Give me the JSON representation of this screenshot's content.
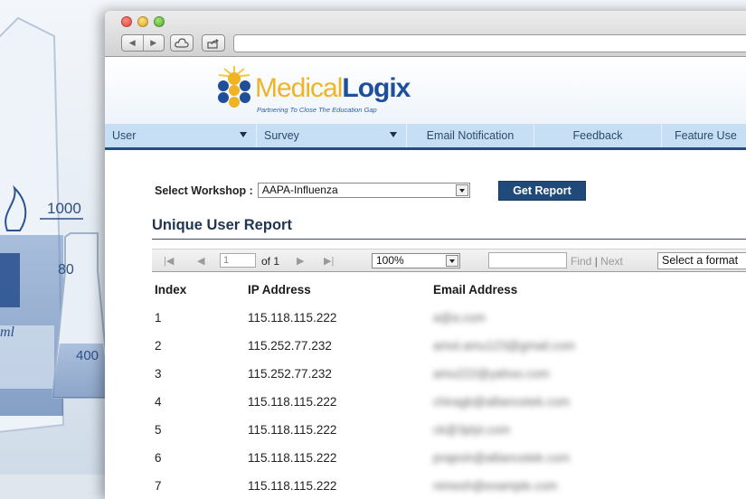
{
  "browser": {
    "nav_back_icon": "back-arrow-icon",
    "nav_forward_icon": "forward-arrow-icon",
    "cloud_icon": "cloud-icon",
    "share_icon": "share-icon"
  },
  "brand": {
    "name_part1": "Medical",
    "name_part2": "Logix",
    "tagline": "Partnering To Close The Education Gap",
    "colors": {
      "gold": "#f0b323",
      "blue": "#1f4f9a"
    }
  },
  "menu": {
    "items": [
      {
        "label": "User",
        "dropdown": true
      },
      {
        "label": "Survey",
        "dropdown": true
      },
      {
        "label": "Email Notification",
        "dropdown": false
      },
      {
        "label": "Feedback",
        "dropdown": false
      },
      {
        "label": "Feature Use",
        "dropdown": false
      }
    ]
  },
  "workshop": {
    "label": "Select Workshop :",
    "selected": "AAPA-Influenza",
    "button": "Get Report"
  },
  "report": {
    "title": "Unique User Report",
    "toolbar": {
      "page_value": "1",
      "page_of": "of 1",
      "zoom": "100%",
      "find_label": "Find",
      "separator": "|",
      "next_label": "Next",
      "format_placeholder": "Select a format"
    },
    "columns": [
      "Index",
      "IP Address",
      "Email Address"
    ],
    "rows": [
      {
        "index": "1",
        "ip": "115.118.115.222",
        "email": "a@a.com"
      },
      {
        "index": "2",
        "ip": "115.252.77.232",
        "email": "amol.amu123@gmail.com"
      },
      {
        "index": "3",
        "ip": "115.252.77.232",
        "email": "amu222@yahoo.com"
      },
      {
        "index": "4",
        "ip": "115.118.115.222",
        "email": "chiragb@alliancetek.com"
      },
      {
        "index": "5",
        "ip": "115.118.115.222",
        "email": "ck@3plyt.com"
      },
      {
        "index": "6",
        "ip": "115.118.115.222",
        "email": "prajesh@alliancetek.com"
      },
      {
        "index": "7",
        "ip": "115.118.115.222",
        "email": "nimesh@example.com"
      }
    ]
  },
  "background": {
    "beaker_mark_1": "1000",
    "beaker_mark_2": "80",
    "flask_mark": "400",
    "unit": "ml"
  }
}
